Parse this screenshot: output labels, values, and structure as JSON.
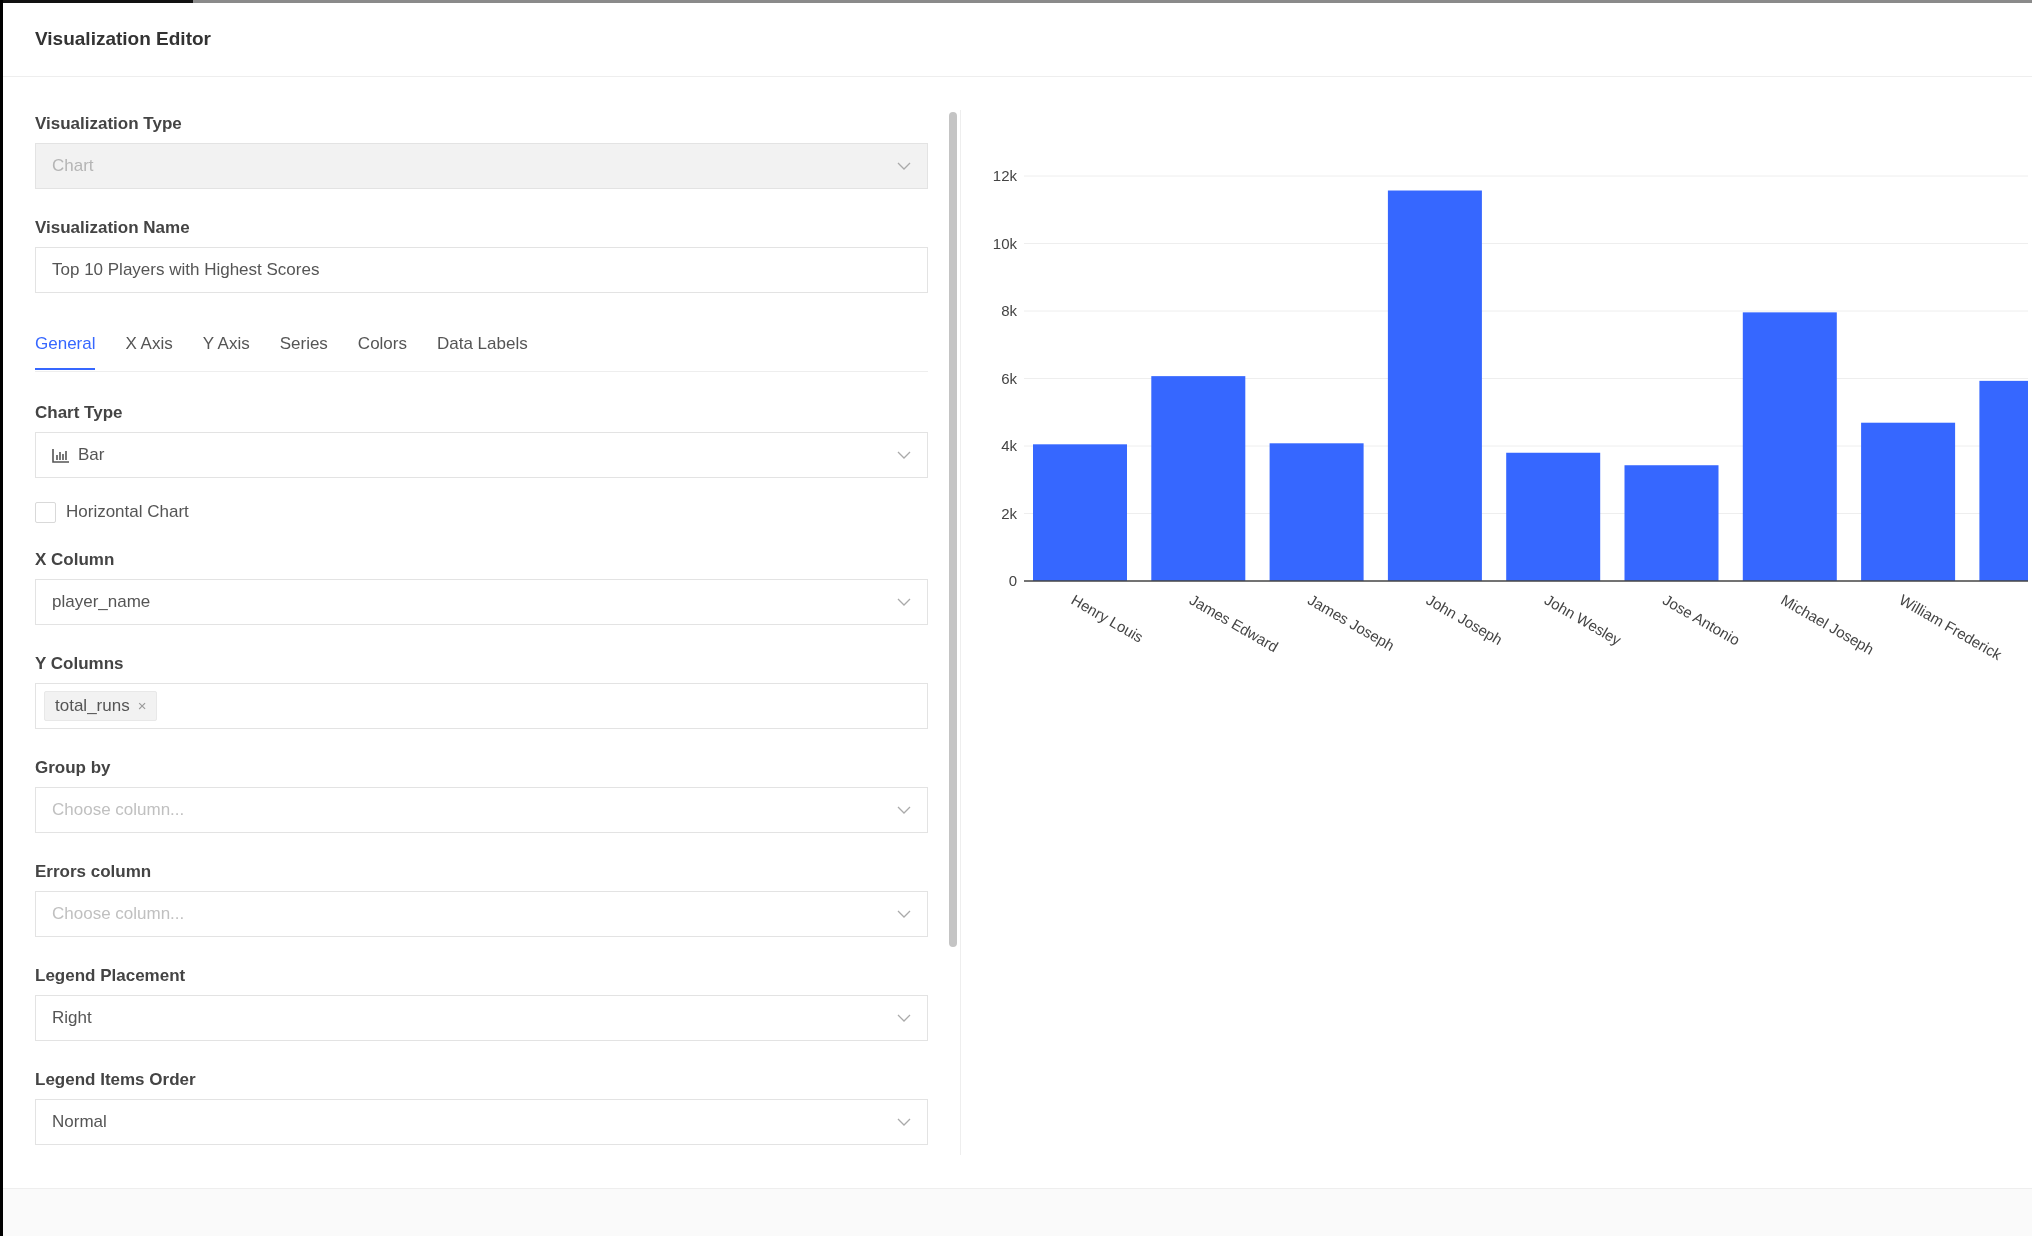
{
  "title": "Visualization Editor",
  "top_fields": [
    {
      "kind": "select",
      "label": "Visualization Type",
      "value": "Chart",
      "disabled": true
    },
    {
      "kind": "text",
      "label": "Visualization Name",
      "value": "Top 10 Players with Highest Scores",
      "disabled": false
    }
  ],
  "tabs": [
    {
      "label": "General",
      "selected": true
    },
    {
      "label": "X Axis",
      "selected": false
    },
    {
      "label": "Y Axis",
      "selected": false
    },
    {
      "label": "Series",
      "selected": false
    },
    {
      "label": "Colors",
      "selected": false
    },
    {
      "label": "Data Labels",
      "selected": false
    }
  ],
  "general_fields": [
    {
      "kind": "chart_type_select",
      "label": "Chart Type",
      "value": "Bar",
      "disabled": false
    },
    {
      "kind": "checkbox",
      "label": "Horizontal Chart",
      "checked": false
    },
    {
      "kind": "select",
      "label": "X Column",
      "value": "player_name",
      "disabled": false
    },
    {
      "kind": "tags",
      "label": "Y Columns",
      "tags": [
        "total_runs"
      ],
      "remove_mark": "×"
    },
    {
      "kind": "select",
      "label": "Group by",
      "placeholder": "Choose column...",
      "disabled": false
    },
    {
      "kind": "select",
      "label": "Errors column",
      "placeholder": "Choose column...",
      "disabled": false
    },
    {
      "kind": "select",
      "label": "Legend Placement",
      "value": "Right",
      "disabled": false
    },
    {
      "kind": "select",
      "label": "Legend Items Order",
      "value": "Normal",
      "disabled": false
    }
  ],
  "chart": {
    "chart_data": {
      "type": "bar",
      "categories": [
        "Henry Louis",
        "James Edward",
        "James Joseph",
        "John Joseph",
        "John Wesley",
        "Jose Antonio",
        "Michael Joseph",
        "William Frederick",
        null
      ],
      "series": [
        {
          "color": "#3667ff",
          "values": [
            4050,
            6070,
            4080,
            11570,
            3800,
            3430,
            7960,
            4690,
            5930
          ]
        }
      ],
      "grid": true,
      "ylim": [
        0,
        12000
      ],
      "yticks": [
        {
          "value": 0,
          "label": "0"
        },
        {
          "value": 2000,
          "label": "2k"
        },
        {
          "value": 4000,
          "label": "4k"
        },
        {
          "value": 6000,
          "label": "6k"
        },
        {
          "value": 8000,
          "label": "8k"
        },
        {
          "value": 10000,
          "label": "10k"
        },
        {
          "value": 12000,
          "label": "12k"
        }
      ]
    }
  }
}
